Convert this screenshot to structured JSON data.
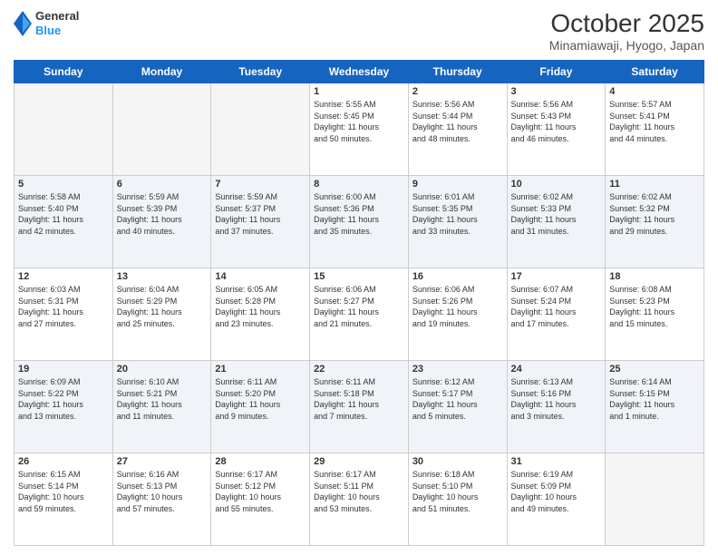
{
  "header": {
    "logo_general": "General",
    "logo_blue": "Blue",
    "month": "October 2025",
    "location": "Minamiawaji, Hyogo, Japan"
  },
  "weekdays": [
    "Sunday",
    "Monday",
    "Tuesday",
    "Wednesday",
    "Thursday",
    "Friday",
    "Saturday"
  ],
  "weeks": [
    [
      {
        "day": "",
        "info": ""
      },
      {
        "day": "",
        "info": ""
      },
      {
        "day": "",
        "info": ""
      },
      {
        "day": "1",
        "info": "Sunrise: 5:55 AM\nSunset: 5:45 PM\nDaylight: 11 hours\nand 50 minutes."
      },
      {
        "day": "2",
        "info": "Sunrise: 5:56 AM\nSunset: 5:44 PM\nDaylight: 11 hours\nand 48 minutes."
      },
      {
        "day": "3",
        "info": "Sunrise: 5:56 AM\nSunset: 5:43 PM\nDaylight: 11 hours\nand 46 minutes."
      },
      {
        "day": "4",
        "info": "Sunrise: 5:57 AM\nSunset: 5:41 PM\nDaylight: 11 hours\nand 44 minutes."
      }
    ],
    [
      {
        "day": "5",
        "info": "Sunrise: 5:58 AM\nSunset: 5:40 PM\nDaylight: 11 hours\nand 42 minutes."
      },
      {
        "day": "6",
        "info": "Sunrise: 5:59 AM\nSunset: 5:39 PM\nDaylight: 11 hours\nand 40 minutes."
      },
      {
        "day": "7",
        "info": "Sunrise: 5:59 AM\nSunset: 5:37 PM\nDaylight: 11 hours\nand 37 minutes."
      },
      {
        "day": "8",
        "info": "Sunrise: 6:00 AM\nSunset: 5:36 PM\nDaylight: 11 hours\nand 35 minutes."
      },
      {
        "day": "9",
        "info": "Sunrise: 6:01 AM\nSunset: 5:35 PM\nDaylight: 11 hours\nand 33 minutes."
      },
      {
        "day": "10",
        "info": "Sunrise: 6:02 AM\nSunset: 5:33 PM\nDaylight: 11 hours\nand 31 minutes."
      },
      {
        "day": "11",
        "info": "Sunrise: 6:02 AM\nSunset: 5:32 PM\nDaylight: 11 hours\nand 29 minutes."
      }
    ],
    [
      {
        "day": "12",
        "info": "Sunrise: 6:03 AM\nSunset: 5:31 PM\nDaylight: 11 hours\nand 27 minutes."
      },
      {
        "day": "13",
        "info": "Sunrise: 6:04 AM\nSunset: 5:29 PM\nDaylight: 11 hours\nand 25 minutes."
      },
      {
        "day": "14",
        "info": "Sunrise: 6:05 AM\nSunset: 5:28 PM\nDaylight: 11 hours\nand 23 minutes."
      },
      {
        "day": "15",
        "info": "Sunrise: 6:06 AM\nSunset: 5:27 PM\nDaylight: 11 hours\nand 21 minutes."
      },
      {
        "day": "16",
        "info": "Sunrise: 6:06 AM\nSunset: 5:26 PM\nDaylight: 11 hours\nand 19 minutes."
      },
      {
        "day": "17",
        "info": "Sunrise: 6:07 AM\nSunset: 5:24 PM\nDaylight: 11 hours\nand 17 minutes."
      },
      {
        "day": "18",
        "info": "Sunrise: 6:08 AM\nSunset: 5:23 PM\nDaylight: 11 hours\nand 15 minutes."
      }
    ],
    [
      {
        "day": "19",
        "info": "Sunrise: 6:09 AM\nSunset: 5:22 PM\nDaylight: 11 hours\nand 13 minutes."
      },
      {
        "day": "20",
        "info": "Sunrise: 6:10 AM\nSunset: 5:21 PM\nDaylight: 11 hours\nand 11 minutes."
      },
      {
        "day": "21",
        "info": "Sunrise: 6:11 AM\nSunset: 5:20 PM\nDaylight: 11 hours\nand 9 minutes."
      },
      {
        "day": "22",
        "info": "Sunrise: 6:11 AM\nSunset: 5:18 PM\nDaylight: 11 hours\nand 7 minutes."
      },
      {
        "day": "23",
        "info": "Sunrise: 6:12 AM\nSunset: 5:17 PM\nDaylight: 11 hours\nand 5 minutes."
      },
      {
        "day": "24",
        "info": "Sunrise: 6:13 AM\nSunset: 5:16 PM\nDaylight: 11 hours\nand 3 minutes."
      },
      {
        "day": "25",
        "info": "Sunrise: 6:14 AM\nSunset: 5:15 PM\nDaylight: 11 hours\nand 1 minute."
      }
    ],
    [
      {
        "day": "26",
        "info": "Sunrise: 6:15 AM\nSunset: 5:14 PM\nDaylight: 10 hours\nand 59 minutes."
      },
      {
        "day": "27",
        "info": "Sunrise: 6:16 AM\nSunset: 5:13 PM\nDaylight: 10 hours\nand 57 minutes."
      },
      {
        "day": "28",
        "info": "Sunrise: 6:17 AM\nSunset: 5:12 PM\nDaylight: 10 hours\nand 55 minutes."
      },
      {
        "day": "29",
        "info": "Sunrise: 6:17 AM\nSunset: 5:11 PM\nDaylight: 10 hours\nand 53 minutes."
      },
      {
        "day": "30",
        "info": "Sunrise: 6:18 AM\nSunset: 5:10 PM\nDaylight: 10 hours\nand 51 minutes."
      },
      {
        "day": "31",
        "info": "Sunrise: 6:19 AM\nSunset: 5:09 PM\nDaylight: 10 hours\nand 49 minutes."
      },
      {
        "day": "",
        "info": ""
      }
    ]
  ]
}
